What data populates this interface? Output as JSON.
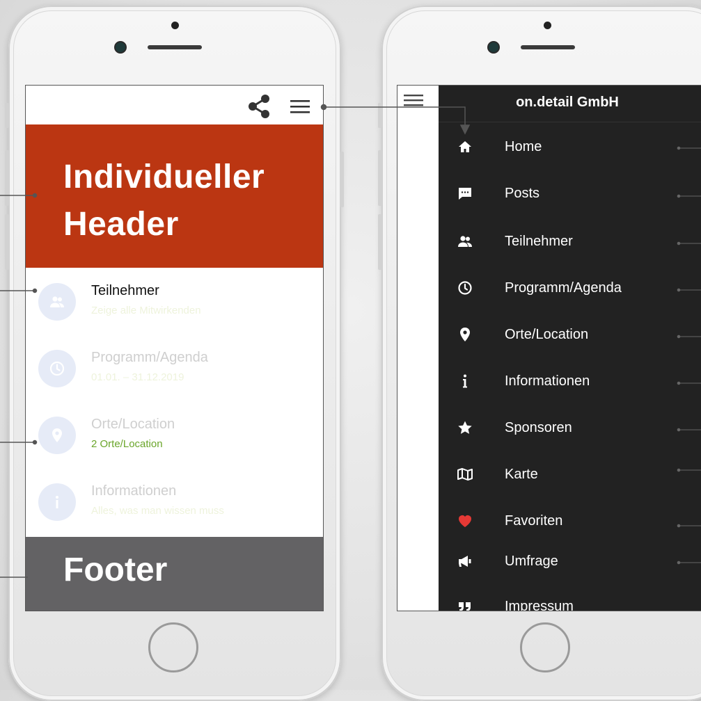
{
  "left_screen": {
    "header_title_line1": "Individueller",
    "header_title_line2": "Header",
    "items": [
      {
        "title": "Teilnehmer",
        "subtitle": "Zeige alle Mitwirkenden"
      },
      {
        "title": "Programm/Agenda",
        "subtitle": "01.01. – 31.12.2019"
      },
      {
        "title": "Orte/Location",
        "subtitle": "2 Orte/Location"
      },
      {
        "title": "Informationen",
        "subtitle": "Alles, was man wissen muss"
      }
    ],
    "footer_title": "Footer"
  },
  "right_screen": {
    "drawer_title": "on.detail GmbH",
    "nav_items": [
      {
        "label": "Home",
        "icon": "home-icon"
      },
      {
        "label": "Posts",
        "icon": "chat-icon"
      },
      {
        "label": "Teilnehmer",
        "icon": "users-icon"
      },
      {
        "label": "Programm/Agenda",
        "icon": "clock-icon"
      },
      {
        "label": "Orte/Location",
        "icon": "map-pin-icon"
      },
      {
        "label": "Informationen",
        "icon": "info-icon"
      },
      {
        "label": "Sponsoren",
        "icon": "star-icon"
      },
      {
        "label": "Karte",
        "icon": "map-icon"
      },
      {
        "label": "Favoriten",
        "icon": "heart-icon"
      },
      {
        "label": "Umfrage",
        "icon": "megaphone-icon"
      },
      {
        "label": "Impressum",
        "icon": "quote-icon"
      }
    ]
  },
  "colors": {
    "header_red": "#bb3612",
    "footer_gray": "#636264",
    "drawer_bg": "#222222",
    "accent_green": "#6aa52a",
    "heart_red": "#e53935"
  }
}
